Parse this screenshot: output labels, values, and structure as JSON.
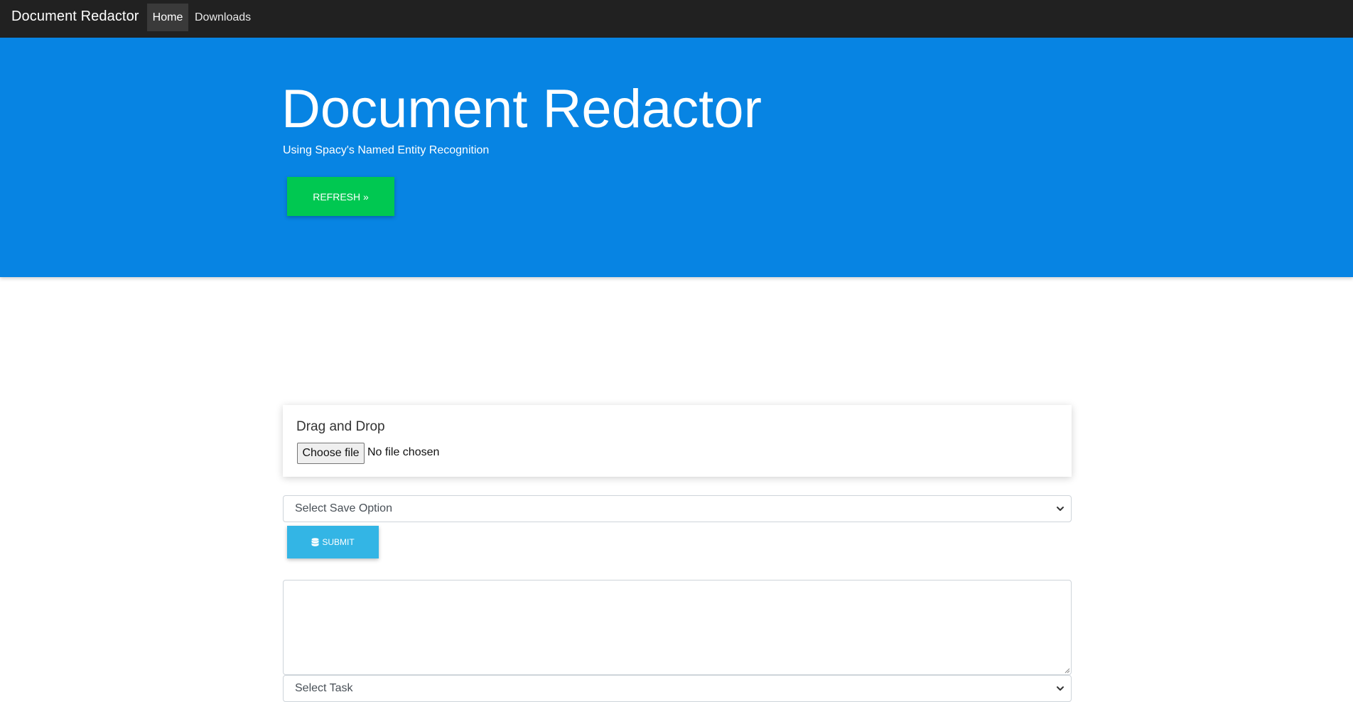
{
  "navbar": {
    "brand": "Document Redactor",
    "links": [
      {
        "label": "Home",
        "active": true
      },
      {
        "label": "Downloads",
        "active": false
      }
    ]
  },
  "hero": {
    "title": "Document Redactor",
    "subtitle": "Using Spacy's Named Entity Recognition",
    "refresh_label": "REFRESH »"
  },
  "upload": {
    "title": "Drag and Drop",
    "choose_label": "Choose file",
    "status": "No file chosen"
  },
  "save_select": {
    "selected": "Select Save Option"
  },
  "submit": {
    "label": "SUBMIT",
    "icon": "database-icon"
  },
  "text_input": {
    "value": ""
  },
  "task_select": {
    "selected": "Select Task"
  },
  "colors": {
    "navbar": "#212121",
    "hero": "#0784e3",
    "refresh": "#00c851",
    "submit": "#33b5e5"
  }
}
